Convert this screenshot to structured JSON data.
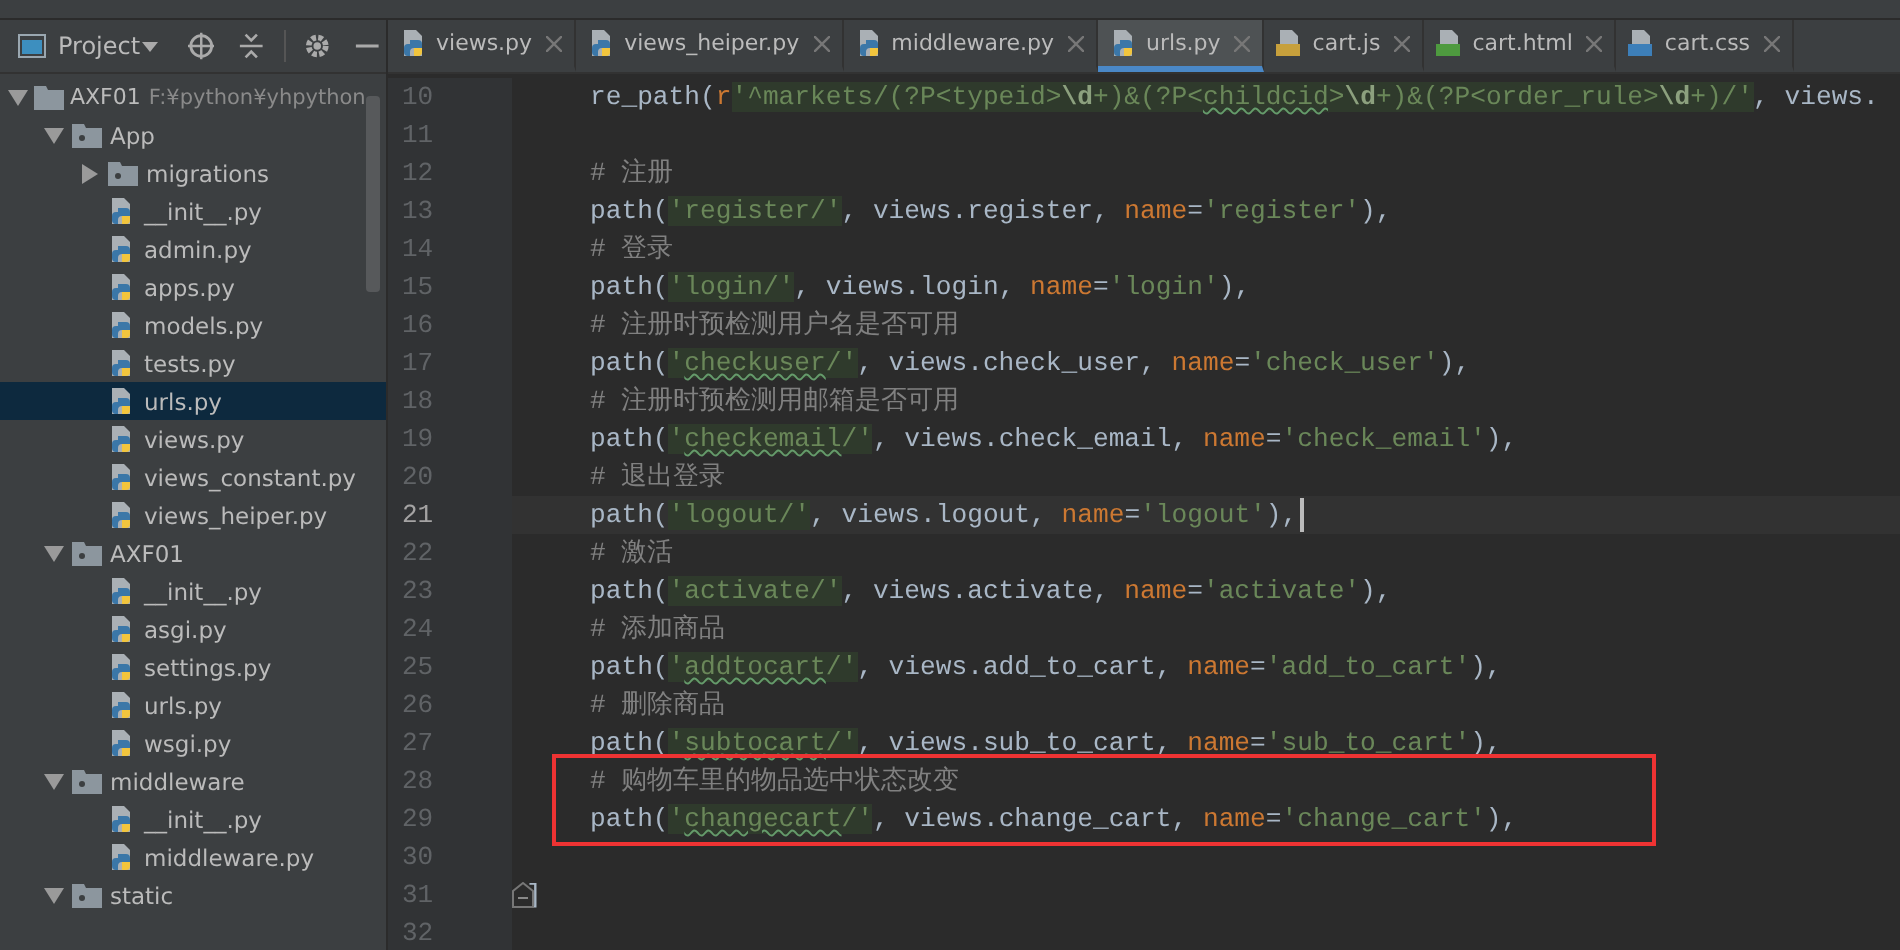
{
  "project_panel": {
    "title": "Project",
    "tree": [
      {
        "label": "AXF01",
        "path": "F:¥python¥yhpython",
        "kind": "folder",
        "expanded": true,
        "selected": false,
        "children": [
          {
            "label": "App",
            "kind": "package",
            "expanded": true,
            "selected": false,
            "children": [
              {
                "label": "migrations",
                "kind": "package",
                "expanded": false,
                "selected": false
              },
              {
                "label": "__init__.py",
                "kind": "py",
                "selected": false
              },
              {
                "label": "admin.py",
                "kind": "py",
                "selected": false
              },
              {
                "label": "apps.py",
                "kind": "py",
                "selected": false
              },
              {
                "label": "models.py",
                "kind": "py",
                "selected": false
              },
              {
                "label": "tests.py",
                "kind": "py",
                "selected": false
              },
              {
                "label": "urls.py",
                "kind": "py",
                "selected": true
              },
              {
                "label": "views.py",
                "kind": "py",
                "selected": false
              },
              {
                "label": "views_constant.py",
                "kind": "py",
                "selected": false
              },
              {
                "label": "views_heiper.py",
                "kind": "py",
                "selected": false
              }
            ]
          },
          {
            "label": "AXF01",
            "kind": "package",
            "expanded": true,
            "selected": false,
            "children": [
              {
                "label": "__init__.py",
                "kind": "py",
                "selected": false
              },
              {
                "label": "asgi.py",
                "kind": "py",
                "selected": false
              },
              {
                "label": "settings.py",
                "kind": "py",
                "selected": false
              },
              {
                "label": "urls.py",
                "kind": "py",
                "selected": false
              },
              {
                "label": "wsgi.py",
                "kind": "py",
                "selected": false
              }
            ]
          },
          {
            "label": "middleware",
            "kind": "package",
            "expanded": true,
            "selected": false,
            "children": [
              {
                "label": "__init__.py",
                "kind": "py",
                "selected": false
              },
              {
                "label": "middleware.py",
                "kind": "py",
                "selected": false
              }
            ]
          },
          {
            "label": "static",
            "kind": "package",
            "expanded": true,
            "selected": false
          }
        ]
      }
    ]
  },
  "tabs": [
    {
      "label": "views.py",
      "kind": "py",
      "selected": false
    },
    {
      "label": "views_heiper.py",
      "kind": "py",
      "selected": false
    },
    {
      "label": "middleware.py",
      "kind": "py",
      "selected": false
    },
    {
      "label": "urls.py",
      "kind": "py",
      "selected": true
    },
    {
      "label": "cart.js",
      "kind": "js",
      "selected": false
    },
    {
      "label": "cart.html",
      "kind": "html",
      "selected": false
    },
    {
      "label": "cart.css",
      "kind": "css",
      "selected": false
    }
  ],
  "editor": {
    "lines": [
      {
        "number": "10",
        "current": false,
        "tokens": [
          {
            "text": "re_path(",
            "kind": "plain"
          },
          {
            "text": "r",
            "kind": "kw"
          },
          {
            "text": "'^markets/(?P<typeid>",
            "kind": "route"
          },
          {
            "text": "\\d",
            "kind": "route-bold"
          },
          {
            "text": "+)&(?P<",
            "kind": "route"
          },
          {
            "text": "childcid",
            "kind": "route",
            "typo": true
          },
          {
            "text": ">",
            "kind": "route"
          },
          {
            "text": "\\d",
            "kind": "route-bold"
          },
          {
            "text": "+)&(?P<order_rule>",
            "kind": "route"
          },
          {
            "text": "\\d",
            "kind": "route-bold"
          },
          {
            "text": "+)/'",
            "kind": "route"
          },
          {
            "text": ", views.",
            "kind": "plain"
          }
        ]
      },
      {
        "number": "11",
        "current": false
      },
      {
        "number": "12",
        "current": false,
        "tokens": [
          {
            "text": "# 注册",
            "kind": "comment"
          }
        ]
      },
      {
        "number": "13",
        "current": false,
        "tokens": [
          {
            "text": "path(",
            "kind": "plain"
          },
          {
            "text": "'register/'",
            "kind": "route"
          },
          {
            "text": ", views.register, ",
            "kind": "plain"
          },
          {
            "text": "name",
            "kind": "kw"
          },
          {
            "text": "=",
            "kind": "plain"
          },
          {
            "text": "'register'",
            "kind": "str"
          },
          {
            "text": "),",
            "kind": "plain"
          }
        ]
      },
      {
        "number": "14",
        "current": false,
        "tokens": [
          {
            "text": "# 登录",
            "kind": "comment"
          }
        ]
      },
      {
        "number": "15",
        "current": false,
        "tokens": [
          {
            "text": "path(",
            "kind": "plain"
          },
          {
            "text": "'login/'",
            "kind": "route"
          },
          {
            "text": ", views.login, ",
            "kind": "plain"
          },
          {
            "text": "name",
            "kind": "kw"
          },
          {
            "text": "=",
            "kind": "plain"
          },
          {
            "text": "'login'",
            "kind": "str"
          },
          {
            "text": "),",
            "kind": "plain"
          }
        ]
      },
      {
        "number": "16",
        "current": false,
        "tokens": [
          {
            "text": "# 注册时预检测用户名是否可用",
            "kind": "comment"
          }
        ]
      },
      {
        "number": "17",
        "current": false,
        "tokens": [
          {
            "text": "path(",
            "kind": "plain"
          },
          {
            "text": "'",
            "kind": "route"
          },
          {
            "text": "checkuser",
            "kind": "route",
            "typo": true
          },
          {
            "text": "/'",
            "kind": "route"
          },
          {
            "text": ", views.check_user, ",
            "kind": "plain"
          },
          {
            "text": "name",
            "kind": "kw"
          },
          {
            "text": "=",
            "kind": "plain"
          },
          {
            "text": "'check_user'",
            "kind": "str"
          },
          {
            "text": "),",
            "kind": "plain"
          }
        ]
      },
      {
        "number": "18",
        "current": false,
        "tokens": [
          {
            "text": "# 注册时预检测用邮箱是否可用",
            "kind": "comment"
          }
        ]
      },
      {
        "number": "19",
        "current": false,
        "tokens": [
          {
            "text": "path(",
            "kind": "plain"
          },
          {
            "text": "'",
            "kind": "route"
          },
          {
            "text": "checkemail",
            "kind": "route",
            "typo": true
          },
          {
            "text": "/'",
            "kind": "route"
          },
          {
            "text": ", views.check_email, ",
            "kind": "plain"
          },
          {
            "text": "name",
            "kind": "kw"
          },
          {
            "text": "=",
            "kind": "plain"
          },
          {
            "text": "'check_email'",
            "kind": "str"
          },
          {
            "text": "),",
            "kind": "plain"
          }
        ]
      },
      {
        "number": "20",
        "current": false,
        "tokens": [
          {
            "text": "# 退出登录",
            "kind": "comment"
          }
        ]
      },
      {
        "number": "21",
        "current": true,
        "tokens": [
          {
            "text": "path(",
            "kind": "plain"
          },
          {
            "text": "'logout/'",
            "kind": "route"
          },
          {
            "text": ", views.logout, ",
            "kind": "plain"
          },
          {
            "text": "name",
            "kind": "kw"
          },
          {
            "text": "=",
            "kind": "plain"
          },
          {
            "text": "'logout'",
            "kind": "str"
          },
          {
            "text": "),",
            "kind": "plain"
          }
        ]
      },
      {
        "number": "22",
        "current": false,
        "tokens": [
          {
            "text": "# 激活",
            "kind": "comment"
          }
        ]
      },
      {
        "number": "23",
        "current": false,
        "tokens": [
          {
            "text": "path(",
            "kind": "plain"
          },
          {
            "text": "'activate/'",
            "kind": "route"
          },
          {
            "text": ", views.activate, ",
            "kind": "plain"
          },
          {
            "text": "name",
            "kind": "kw"
          },
          {
            "text": "=",
            "kind": "plain"
          },
          {
            "text": "'activate'",
            "kind": "str"
          },
          {
            "text": "),",
            "kind": "plain"
          }
        ]
      },
      {
        "number": "24",
        "current": false,
        "tokens": [
          {
            "text": "# 添加商品",
            "kind": "comment"
          }
        ]
      },
      {
        "number": "25",
        "current": false,
        "tokens": [
          {
            "text": "path(",
            "kind": "plain"
          },
          {
            "text": "'",
            "kind": "route"
          },
          {
            "text": "addtocart",
            "kind": "route",
            "typo": true
          },
          {
            "text": "/'",
            "kind": "route"
          },
          {
            "text": ", views.add_to_cart, ",
            "kind": "plain"
          },
          {
            "text": "name",
            "kind": "kw"
          },
          {
            "text": "=",
            "kind": "plain"
          },
          {
            "text": "'add_to_cart'",
            "kind": "str"
          },
          {
            "text": "),",
            "kind": "plain"
          }
        ]
      },
      {
        "number": "26",
        "current": false,
        "tokens": [
          {
            "text": "# 删除商品",
            "kind": "comment"
          }
        ]
      },
      {
        "number": "27",
        "current": false,
        "tokens": [
          {
            "text": "path(",
            "kind": "plain"
          },
          {
            "text": "'",
            "kind": "route"
          },
          {
            "text": "subtocart",
            "kind": "route",
            "typo": true
          },
          {
            "text": "/'",
            "kind": "route"
          },
          {
            "text": ", views.sub_to_cart, ",
            "kind": "plain"
          },
          {
            "text": "name",
            "kind": "kw"
          },
          {
            "text": "=",
            "kind": "plain"
          },
          {
            "text": "'sub_to_cart'",
            "kind": "str"
          },
          {
            "text": "),",
            "kind": "plain"
          }
        ]
      },
      {
        "number": "28",
        "current": false,
        "boxed": true,
        "tokens": [
          {
            "text": "# 购物车里的物品选中状态改变",
            "kind": "comment"
          }
        ]
      },
      {
        "number": "29",
        "current": false,
        "boxed": true,
        "tokens": [
          {
            "text": "path(",
            "kind": "plain"
          },
          {
            "text": "'",
            "kind": "route"
          },
          {
            "text": "changecart",
            "kind": "route",
            "typo": true
          },
          {
            "text": "/'",
            "kind": "route"
          },
          {
            "text": ", views.change_cart, ",
            "kind": "plain"
          },
          {
            "text": "name",
            "kind": "kw"
          },
          {
            "text": "=",
            "kind": "plain"
          },
          {
            "text": "'change_cart'",
            "kind": "str"
          },
          {
            "text": "),",
            "kind": "plain"
          }
        ]
      },
      {
        "number": "30",
        "current": false
      },
      {
        "number": "31",
        "current": false,
        "fold": true,
        "tokens": [
          {
            "text": "]",
            "kind": "plain"
          }
        ]
      },
      {
        "number": "32",
        "current": false
      }
    ]
  }
}
